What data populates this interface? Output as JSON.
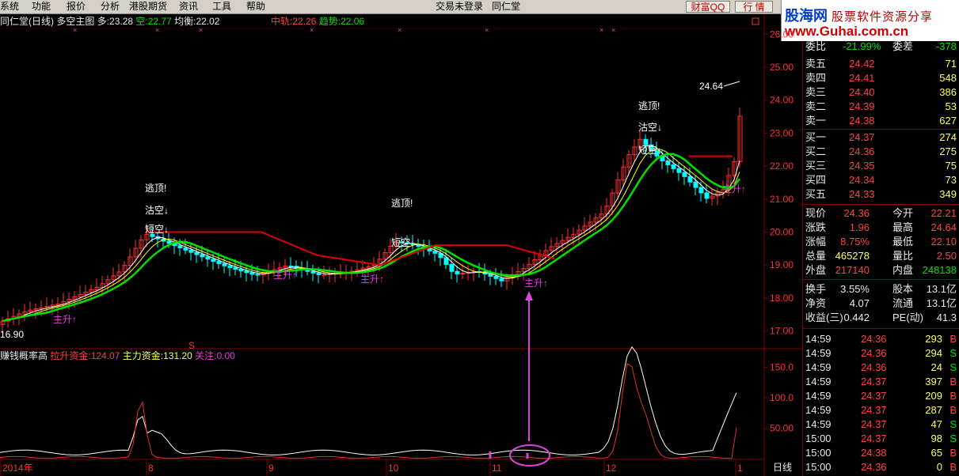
{
  "menu": {
    "items": [
      "系统",
      "功能",
      "报价",
      "分析",
      "港股期货",
      "资讯",
      "工具",
      "帮助"
    ],
    "login_status": "交易未登录",
    "broker": "同仁堂",
    "btn_caifuqq": "财富QQ",
    "btn_hangqing": "行 情"
  },
  "logo": {
    "line1_a": "股海网",
    "line1_b": "股票软件资源分享",
    "line2": "www.Guhai.com.cn"
  },
  "chart_header": {
    "title": "同仁堂(日线) 多空主图",
    "duo_label": "多:",
    "duo_value": "23.28",
    "kong_label": "空:",
    "kong_value": "22.77",
    "junheng_label": "均衡:",
    "junheng_value": "22.02",
    "zhonggui_label": "中轨:",
    "zhonggui_value": "22.26",
    "qushi_label": "趋势:",
    "qushi_value": "22.06"
  },
  "annotations": {
    "taoding": "逃顶!",
    "gukong": "沽空↓",
    "duankong": "短空↓",
    "zhusheng": "主升↑",
    "high_price": "24.64",
    "low_price": "16.90",
    "s_marker": "S"
  },
  "indicator_header": {
    "name": "赚钱概率高",
    "lasheng_label": "拉升资金:",
    "lasheng_value": "124.07",
    "zhuli_label": "主力资金:",
    "zhuli_value": "131.20",
    "guanzhu_label": "关注:",
    "guanzhu_value": "0.00"
  },
  "price_axis": [
    "26.00",
    "25.00",
    "24.00",
    "23.00",
    "22.00",
    "21.00",
    "20.00",
    "19.00",
    "18.00",
    "17.00"
  ],
  "indicator_axis": [
    "150.0",
    "100.0",
    "50.00"
  ],
  "date_axis": [
    "2014年",
    "8",
    "9",
    "10",
    "11",
    "12",
    "1"
  ],
  "period_label": "日线",
  "order_book": {
    "weibi_label": "委比",
    "weibi_value": "-21.99%",
    "weicha_label": "委差",
    "weicha_value": "-378",
    "asks": [
      {
        "label": "卖五",
        "price": "24.42",
        "vol": "71"
      },
      {
        "label": "卖四",
        "price": "24.41",
        "vol": "548"
      },
      {
        "label": "卖三",
        "price": "24.40",
        "vol": "386"
      },
      {
        "label": "卖二",
        "price": "24.39",
        "vol": "53"
      },
      {
        "label": "卖一",
        "price": "24.38",
        "vol": "627"
      }
    ],
    "bids": [
      {
        "label": "买一",
        "price": "24.37",
        "vol": "274"
      },
      {
        "label": "买二",
        "price": "24.36",
        "vol": "275"
      },
      {
        "label": "买三",
        "price": "24.35",
        "vol": "75"
      },
      {
        "label": "买四",
        "price": "24.34",
        "vol": "73"
      },
      {
        "label": "买五",
        "price": "24.33",
        "vol": "349"
      }
    ]
  },
  "quote": [
    {
      "l1": "现价",
      "v1": "24.36",
      "c1": "r",
      "l2": "今开",
      "v2": "22.21",
      "c2": "r"
    },
    {
      "l1": "涨跌",
      "v1": "1.96",
      "c1": "r",
      "l2": "最高",
      "v2": "24.64",
      "c2": "r"
    },
    {
      "l1": "涨幅",
      "v1": "8.75%",
      "c1": "r",
      "l2": "最低",
      "v2": "22.10",
      "c2": "r"
    },
    {
      "l1": "总量",
      "v1": "465278",
      "c1": "y",
      "l2": "量比",
      "v2": "2.50",
      "c2": "r"
    },
    {
      "l1": "外盘",
      "v1": "217140",
      "c1": "r",
      "l2": "内盘",
      "v2": "248138",
      "c2": "g"
    }
  ],
  "stats": [
    {
      "l1": "换手",
      "v1": "3.55%",
      "l2": "股本",
      "v2": "13.1亿"
    },
    {
      "l1": "净资",
      "v1": "4.07",
      "l2": "流通",
      "v2": "13.1亿"
    },
    {
      "l1": "收益(三)",
      "v1": "0.442",
      "l2": "PE(动)",
      "v2": "41.3"
    }
  ],
  "ticks": [
    {
      "time": "14:59",
      "price": "24.36",
      "vol": "293",
      "side": "B"
    },
    {
      "time": "14:59",
      "price": "24.36",
      "vol": "294",
      "side": "S"
    },
    {
      "time": "14:59",
      "price": "24.36",
      "vol": "24",
      "side": "S"
    },
    {
      "time": "14:59",
      "price": "24.37",
      "vol": "397",
      "side": "B"
    },
    {
      "time": "14:59",
      "price": "24.37",
      "vol": "209",
      "side": "B"
    },
    {
      "time": "14:59",
      "price": "24.37",
      "vol": "287",
      "side": "B"
    },
    {
      "time": "14:59",
      "price": "24.37",
      "vol": "47",
      "side": "S"
    },
    {
      "time": "15:00",
      "price": "24.37",
      "vol": "98",
      "side": "S"
    },
    {
      "time": "15:00",
      "price": "24.38",
      "vol": "65",
      "side": "B"
    },
    {
      "time": "15:00",
      "price": "24.36",
      "vol": "0",
      "side": "B"
    }
  ],
  "colors": {
    "up": "#ff3030",
    "down": "#00ffff",
    "ma_fast": "#ffffff",
    "ma_slow": "#ffff00",
    "trend": "#00e000",
    "resist": "#e00000",
    "indicator_a": "#ffffe0",
    "indicator_b": "#e03030",
    "highlight": "#e040e0"
  }
}
